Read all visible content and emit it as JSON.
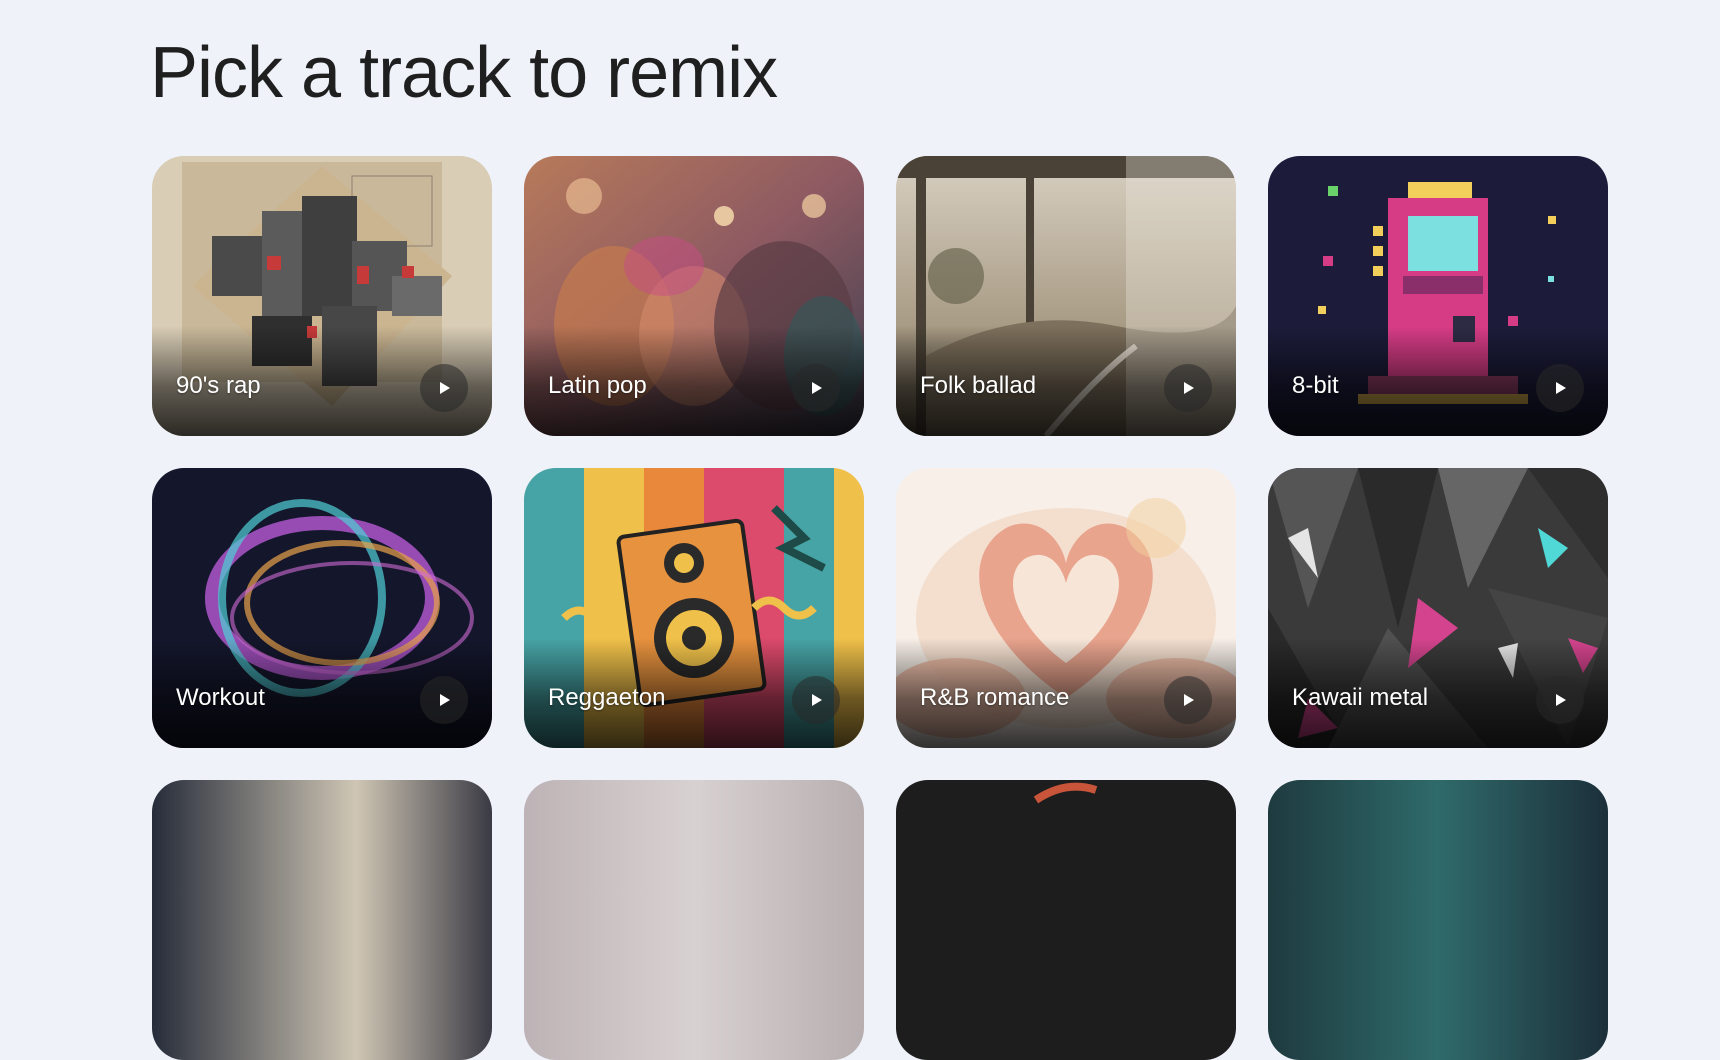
{
  "page": {
    "title": "Pick a track to remix"
  },
  "tracks": [
    {
      "label": "90's rap",
      "art": "collage-cubes-art"
    },
    {
      "label": "Latin pop",
      "art": "dance-crowd-painting"
    },
    {
      "label": "Folk ballad",
      "art": "window-landscape-sepia"
    },
    {
      "label": "8-bit",
      "art": "pixel-arcade-machine"
    },
    {
      "label": "Workout",
      "art": "neon-torus-swirl"
    },
    {
      "label": "Reggaeton",
      "art": "speaker-poster-art"
    },
    {
      "label": "R&B romance",
      "art": "watercolor-heart-hands"
    },
    {
      "label": "Kawaii metal",
      "art": "grunge-triangles-art"
    }
  ],
  "icons": {
    "play": "play-icon"
  }
}
